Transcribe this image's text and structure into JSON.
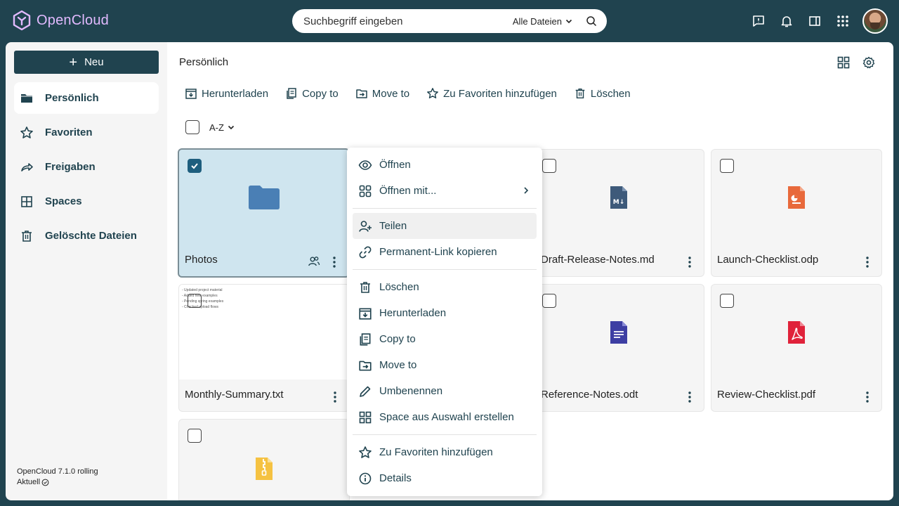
{
  "brand": {
    "name": "OpenCloud"
  },
  "search": {
    "placeholder": "Suchbegriff eingeben",
    "scope": "Alle Dateien"
  },
  "topbar": {
    "icons": [
      "feedback-icon",
      "bell-icon",
      "sidebar-panel-icon",
      "apps-grid-icon"
    ]
  },
  "sidebar": {
    "new_label": "Neu",
    "items": [
      {
        "label": "Persönlich",
        "icon": "folder-icon",
        "active": true
      },
      {
        "label": "Favoriten",
        "icon": "star-icon"
      },
      {
        "label": "Freigaben",
        "icon": "share-arrow-icon"
      },
      {
        "label": "Spaces",
        "icon": "spaces-grid-icon"
      },
      {
        "label": "Gelöschte Dateien",
        "icon": "trash-icon"
      }
    ],
    "version": "OpenCloud 7.1.0 rolling",
    "status": "Aktuell"
  },
  "main": {
    "breadcrumb": "Persönlich",
    "actions": [
      {
        "label": "Herunterladen",
        "icon": "download-icon"
      },
      {
        "label": "Copy to",
        "icon": "copy-icon"
      },
      {
        "label": "Move to",
        "icon": "move-icon"
      },
      {
        "label": "Zu Favoriten hinzufügen",
        "icon": "star-icon"
      },
      {
        "label": "Löschen",
        "icon": "trash-icon"
      }
    ],
    "sort": "A-Z"
  },
  "files": [
    {
      "name": "Photos",
      "type": "folder",
      "selected": true,
      "shared": true
    },
    {
      "name": "Draft-Release-Notes.md",
      "type": "markdown"
    },
    {
      "name": "Launch-Checklist.odp",
      "type": "presentation"
    },
    {
      "name": "Monthly-Summary.txt",
      "type": "text",
      "preview_lines": [
        "- Updated project material",
        "- Added new examples",
        "- Pending spring examples",
        "- Checked upload flows"
      ]
    },
    {
      "name": "Reference-Notes.odt",
      "type": "document"
    },
    {
      "name": "Review-Checklist.pdf",
      "type": "pdf"
    },
    {
      "name": "",
      "type": "archive"
    }
  ],
  "context_menu": {
    "items": [
      {
        "label": "Öffnen",
        "icon": "eye-icon"
      },
      {
        "label": "Öffnen mit...",
        "icon": "apps-icon",
        "submenu": true
      },
      {
        "label": "Teilen",
        "icon": "add-user-icon",
        "hover": true
      },
      {
        "label": "Permanent-Link kopieren",
        "icon": "link-icon"
      },
      {
        "label": "Löschen",
        "icon": "trash-icon"
      },
      {
        "label": "Herunterladen",
        "icon": "download-icon"
      },
      {
        "label": "Copy to",
        "icon": "copy-icon"
      },
      {
        "label": "Move to",
        "icon": "move-icon"
      },
      {
        "label": "Umbenennen",
        "icon": "pencil-icon"
      },
      {
        "label": "Space aus Auswahl erstellen",
        "icon": "spaces-grid-icon"
      },
      {
        "label": "Zu Favoriten hinzufügen",
        "icon": "star-icon"
      },
      {
        "label": "Details",
        "icon": "info-icon"
      }
    ]
  },
  "colors": {
    "brand_dark": "#20434f",
    "logo_accent": "#e2baff",
    "selected_tile": "#cfe5ef",
    "folder": "#4a7fb5",
    "markdown": "#3e5a7a",
    "presentation": "#e8693b",
    "document": "#3d3ea3",
    "pdf": "#e0223a",
    "archive": "#f5c242"
  }
}
